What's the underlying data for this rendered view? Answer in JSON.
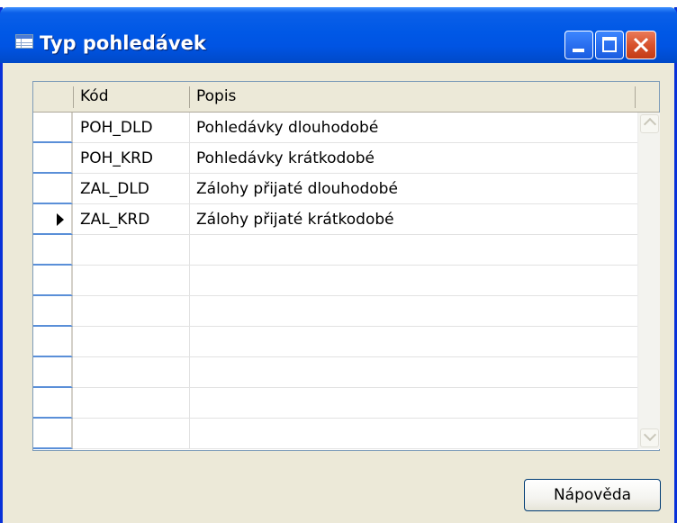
{
  "window": {
    "title": "Typ pohledávek",
    "icon": "table-icon"
  },
  "titlebar_buttons": [
    "minimize-icon",
    "maximize-icon",
    "close-icon"
  ],
  "grid": {
    "columns": [
      "Kód",
      "Popis"
    ],
    "rows": [
      {
        "code": "POH_DLD",
        "description": "Pohledávky dlouhodobé",
        "current": false
      },
      {
        "code": "POH_KRD",
        "description": "Pohledávky krátkodobé",
        "current": false
      },
      {
        "code": "ZAL_DLD",
        "description": "Zálohy přijaté dlouhodobé",
        "current": false
      },
      {
        "code": "ZAL_KRD",
        "description": "Zálohy přijaté krátkodobé",
        "current": true
      }
    ],
    "current_row_indicator": "triangle-right-icon"
  },
  "buttons": {
    "help_label": "Nápověda"
  },
  "colors": {
    "titlebar": "#0054e3",
    "window_bg": "#ece9d8",
    "close_button": "#d8522c"
  }
}
